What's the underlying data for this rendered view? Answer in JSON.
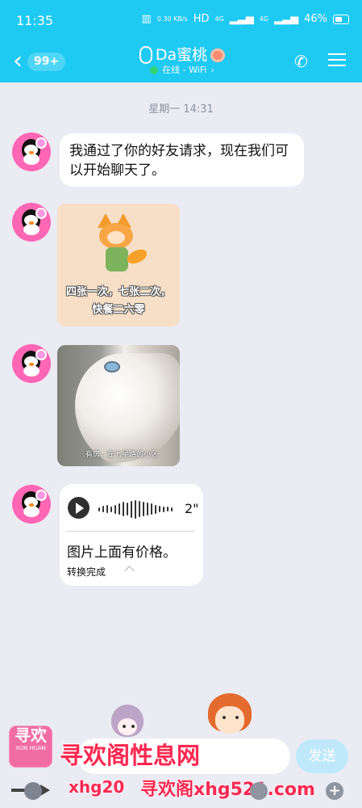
{
  "status_bar": {
    "time": "11:35",
    "speed": "0.30\nKB/s",
    "hd": "HD",
    "network1": "4G",
    "network2": "4G",
    "battery": "46%"
  },
  "header": {
    "back_label": "99+",
    "title": "Da蜜桃",
    "status": "在线 - WiFi",
    "accent": "#1ec9f2"
  },
  "chat": {
    "timestamp": "星期一 14:31",
    "first_message": "我通过了你的好友请求，现在我们可以开始聊天了。",
    "sticker_text": "四张一次，七张二次，快餐二六零",
    "cat_caption": "有房，在七星路的小区",
    "voice": {
      "duration": "2\"",
      "transcript": "图片上面有价格。",
      "convert_status": "转换完成"
    }
  },
  "input": {
    "placeholder": "",
    "send_label": "发送"
  },
  "watermark": {
    "logo_text": "寻欢",
    "logo_subtext": "XUN\nHUAN",
    "title": "寻欢阁性息网",
    "url_left": "xhg20",
    "url_right": "寻欢阁xhg521.com"
  },
  "icons": {
    "back": "chevron-left-icon",
    "phone": "phone-icon",
    "menu": "menu-icon",
    "play": "play-icon",
    "mic": "mic-icon",
    "emoji": "emoji-icon",
    "plus": "plus-icon"
  }
}
